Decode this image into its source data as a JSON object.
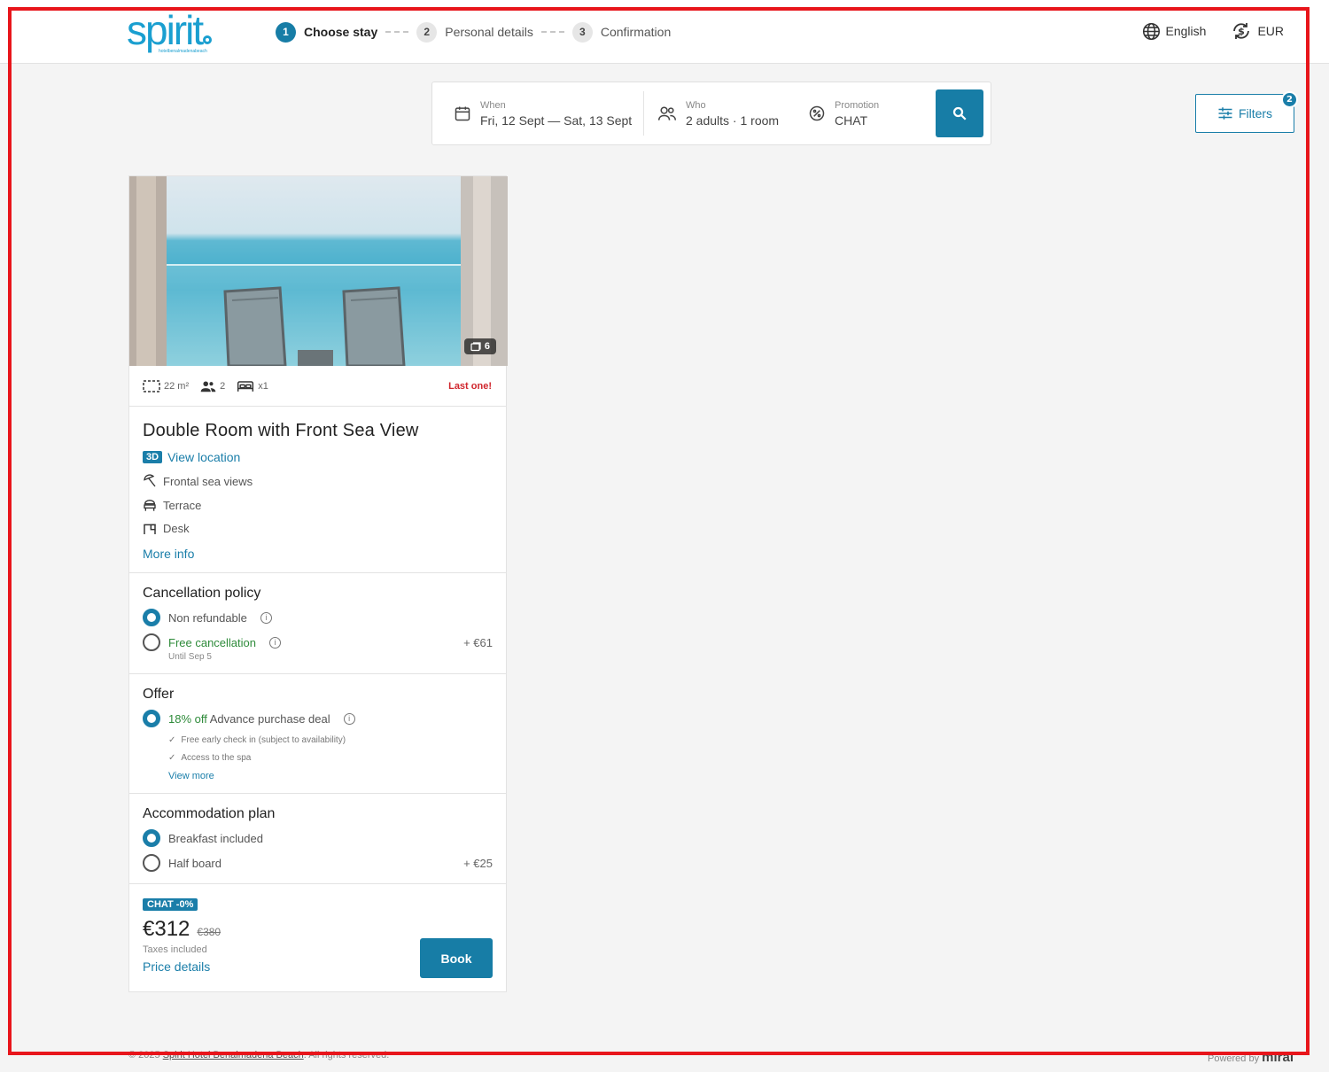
{
  "header": {
    "logo_word": "spirit",
    "logo_tagline": "hotelbenalmadenabeach",
    "steps": [
      {
        "num": "1",
        "label": "Choose stay",
        "active": true
      },
      {
        "num": "2",
        "label": "Personal details",
        "active": false
      },
      {
        "num": "3",
        "label": "Confirmation",
        "active": false
      }
    ],
    "language": "English",
    "currency": "EUR"
  },
  "search": {
    "when_label": "When",
    "when_value": "Fri, 12 Sept — Sat, 13 Sept",
    "who_label": "Who",
    "who_value": "2 adults · 1 room",
    "promo_label": "Promotion",
    "promo_value": "CHAT"
  },
  "filters": {
    "label": "Filters",
    "badge": "2"
  },
  "room": {
    "photo_count": "6",
    "size": "22 m²",
    "guests": "2",
    "beds": "x1",
    "availability": "Last one!",
    "title": "Double Room with Front Sea View",
    "badge_3d": "3D",
    "view_location": "View location",
    "features": [
      "Frontal sea views",
      "Terrace",
      "Desk"
    ],
    "more_info": "More info",
    "cancellation": {
      "title": "Cancellation policy",
      "options": [
        {
          "label": "Non refundable",
          "selected": true,
          "extra": ""
        },
        {
          "label": "Free cancellation",
          "selected": false,
          "extra": "+ €61",
          "note": "Until Sep 5"
        }
      ]
    },
    "offer": {
      "title": "Offer",
      "discount": "18% off",
      "label": "Advance purchase deal",
      "perks": [
        "Free early check in (subject to availability)",
        "Access to the spa"
      ],
      "view_more": "View more"
    },
    "plan": {
      "title": "Accommodation plan",
      "options": [
        {
          "label": "Breakfast included",
          "selected": true,
          "extra": ""
        },
        {
          "label": "Half board",
          "selected": false,
          "extra": "+ €25"
        }
      ]
    },
    "price": {
      "promo_tag": "CHAT -0%",
      "current": "€312",
      "old": "€380",
      "taxes": "Taxes included",
      "details": "Price details",
      "book": "Book"
    }
  },
  "footer": {
    "copyright_prefix": "© 2025",
    "hotel_link": "Spirit Hotel Benalmadena Beach",
    "copyright_suffix": ". All rights reserved.",
    "powered_by": "Powered by",
    "brand": "mirai"
  },
  "colors": {
    "accent": "#177da6",
    "alert": "#d0262d",
    "green": "#2e8b3a",
    "frame": "#e8151b"
  }
}
